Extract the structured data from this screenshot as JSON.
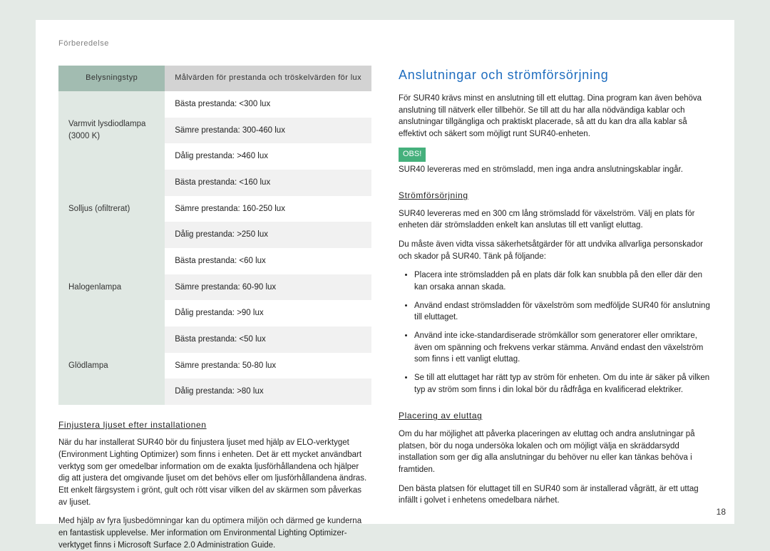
{
  "header": {
    "breadcrumb": "Förberedelse"
  },
  "table": {
    "head_left": "Belysningstyp",
    "head_right": "Målvärden för prestanda och tröskelvärden för lux",
    "rows": [
      {
        "type": "Varmvit lysdiodlampa (3000 K)",
        "vals": [
          "Bästa prestanda: <300 lux",
          "Sämre prestanda: 300-460 lux",
          "Dålig prestanda: >460 lux"
        ]
      },
      {
        "type": "Solljus (ofiltrerat)",
        "vals": [
          "Bästa prestanda: <160 lux",
          "Sämre prestanda: 160-250 lux",
          "Dålig prestanda: >250 lux"
        ]
      },
      {
        "type": "Halogenlampa",
        "vals": [
          "Bästa prestanda: <60 lux",
          "Sämre prestanda: 60-90 lux",
          "Dålig prestanda: >90 lux"
        ]
      },
      {
        "type": "Glödlampa",
        "vals": [
          "Bästa prestanda: <50 lux",
          "Sämre prestanda: 50-80 lux",
          "Dålig prestanda: >80 lux"
        ]
      }
    ]
  },
  "left": {
    "sub1_title": "Finjustera ljuset efter installationen",
    "sub1_p1": "När du har installerat SUR40 bör du finjustera ljuset med hjälp av ELO-verktyget (Environment Lighting Optimizer) som finns i enheten. Det är ett mycket användbart verktyg som ger omedelbar information om de exakta ljusförhållandena och hjälper dig att justera det omgivande ljuset om det behövs eller om ljusförhållandena ändras. Ett enkelt färgsystem i grönt, gult och rött visar vilken del av skärmen som påverkas av ljuset.",
    "sub1_p2": "Med hjälp av fyra ljusbedömningar kan du optimera miljön och därmed ge kunderna en fantastisk upplevelse. Mer information om Environmental Lighting Optimizer-verktyget finns i Microsoft Surface 2.0 Administration Guide."
  },
  "right": {
    "title": "Anslutningar och strömförsörjning",
    "intro": "För SUR40 krävs minst en anslutning till ett eluttag. Dina program kan även behöva anslutning till nätverk eller tillbehör. Se till att du har alla nödvändiga kablar och anslutningar tillgängliga och praktiskt placerade, så att du kan dra alla kablar så effektivt och säkert som möjligt runt SUR40-enheten.",
    "note_label": "OBS!",
    "note_text": "SUR40 levereras med en strömsladd, men inga andra anslutningskablar ingår.",
    "sub1_title": "Strömförsörjning",
    "sub1_p1": "SUR40 levereras med en 300 cm lång strömsladd för växelström. Välj en plats för enheten där strömsladden enkelt kan anslutas till ett vanligt eluttag.",
    "sub1_p2": "Du måste även vidta vissa säkerhetsåtgärder för att undvika allvarliga personskador och skador på SUR40. Tänk på följande:",
    "bullets": [
      "Placera inte strömsladden på en plats där folk kan snubbla på den eller där den kan orsaka annan skada.",
      "Använd endast strömsladden för växelström som medföljde SUR40 för anslutning till eluttaget.",
      "Använd inte icke-standardiserade strömkällor som generatorer eller omriktare, även om spänning och frekvens verkar stämma. Använd endast den växelström som finns i ett vanligt eluttag.",
      "Se till att eluttaget har rätt typ av ström för enheten. Om du inte är säker på vilken typ av ström som finns i din lokal bör du rådfråga en kvalificerad elektriker."
    ],
    "sub2_title": "Placering av eluttag",
    "sub2_p1": "Om du har möjlighet att påverka placeringen av eluttag och andra anslutningar på platsen, bör du noga undersöka lokalen och om möjligt välja en skräddarsydd installation som ger dig alla anslutningar du behöver nu eller kan tänkas behöva i framtiden.",
    "sub2_p2": "Den bästa platsen för eluttaget till en SUR40 som är installerad vågrätt, är ett uttag infällt i golvet i enhetens omedelbara närhet."
  },
  "page_number": "18"
}
